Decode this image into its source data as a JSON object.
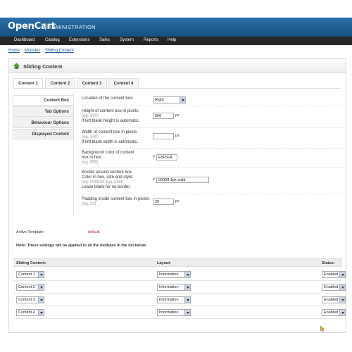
{
  "header": {
    "logo": "OpenCart",
    "subtitle": "ADMINISTRATION"
  },
  "menu": {
    "items": [
      "Dashboard",
      "Catalog",
      "Extensions",
      "Sales",
      "System",
      "Reports",
      "Help"
    ]
  },
  "breadcrumb": {
    "home": "Home",
    "sep1": " :: ",
    "modules": "Modules",
    "sep2": " :: ",
    "current": "Sliding Content"
  },
  "box": {
    "title": "Sliding Content"
  },
  "tabs": [
    "Content 1",
    "Content 2",
    "Content 3",
    "Content 4"
  ],
  "vtabs": [
    "Content Box",
    "Tab Options",
    "Behaviour Options",
    "Displayed Content"
  ],
  "fields": {
    "location": {
      "label": "Location of the content box:",
      "value": "Right"
    },
    "height": {
      "label": "Height of content box in pixels:",
      "help": "(eg. 300)",
      "note": "If left blank height is automatic.",
      "value": "500",
      "unit": "px"
    },
    "width": {
      "label": "Width of content box in pixels:",
      "help": "(eg. 300)",
      "note": "If left blank width is automatic.",
      "value": "",
      "unit": "px"
    },
    "bgcolor": {
      "label": "Background color of content box in hex:",
      "help": "(eg. ffffff)",
      "hash": "#",
      "value": "E5F5FA"
    },
    "border": {
      "label": "Border around content box. Color in hex, size and style:",
      "help": "(eg. 000000 1px solid)",
      "note": "Leave blank for no border.",
      "hash": "#",
      "value": "0000ff 1px solid"
    },
    "padding": {
      "label": "Padding inside content box in pixels:",
      "help": "(eg. 20)",
      "value": "20",
      "unit": "px"
    }
  },
  "template": {
    "label": "Active Template:",
    "value": "default"
  },
  "note": "Note: These settings will be applied to all the modules in the list below.",
  "modules": {
    "headers": {
      "content": "Sliding Content:",
      "layout": "Layout:",
      "status": "Status:"
    },
    "rows": [
      {
        "content": "Content 1",
        "layout": "Information",
        "status": "Enabled"
      },
      {
        "content": "Content 2",
        "layout": "Information",
        "status": "Enabled"
      },
      {
        "content": "Content 3",
        "layout": "Information",
        "status": "Enabled"
      },
      {
        "content": "Content 4",
        "layout": "Information",
        "status": "Enabled"
      }
    ]
  }
}
